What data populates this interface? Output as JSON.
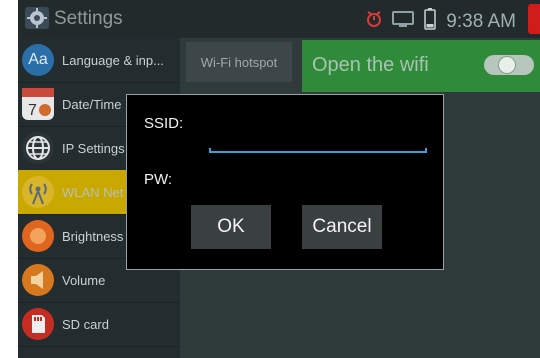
{
  "statusbar": {
    "app_title": "Settings",
    "time": "9:38 AM",
    "icons": [
      "settings-app-icon",
      "alarm-icon",
      "screen-icon",
      "battery-icon"
    ]
  },
  "sidebar": {
    "items": [
      {
        "label": "Language & inp...",
        "icon": "language-icon"
      },
      {
        "label": "Date/Time",
        "icon": "calendar-icon"
      },
      {
        "label": "IP Settings",
        "icon": "globe-icon"
      },
      {
        "label": "WLAN Net",
        "icon": "wifi-antenna-icon",
        "selected": true
      },
      {
        "label": "Brightness",
        "icon": "brightness-icon"
      },
      {
        "label": "Volume",
        "icon": "volume-icon"
      },
      {
        "label": "SD card",
        "icon": "sd-card-icon"
      }
    ]
  },
  "wifi": {
    "hotspot_label": "Wi-Fi hotspot",
    "open_label": "Open the wifi",
    "toggle_state": "off"
  },
  "dialog": {
    "ssid_label": "SSID:",
    "pw_label": "PW:",
    "ssid_value": "",
    "ok_label": "OK",
    "cancel_label": "Cancel"
  },
  "colors": {
    "accent_green": "#2f8a3a",
    "selected_yellow": "#c9a800",
    "input_underline": "#3aa0d8"
  }
}
